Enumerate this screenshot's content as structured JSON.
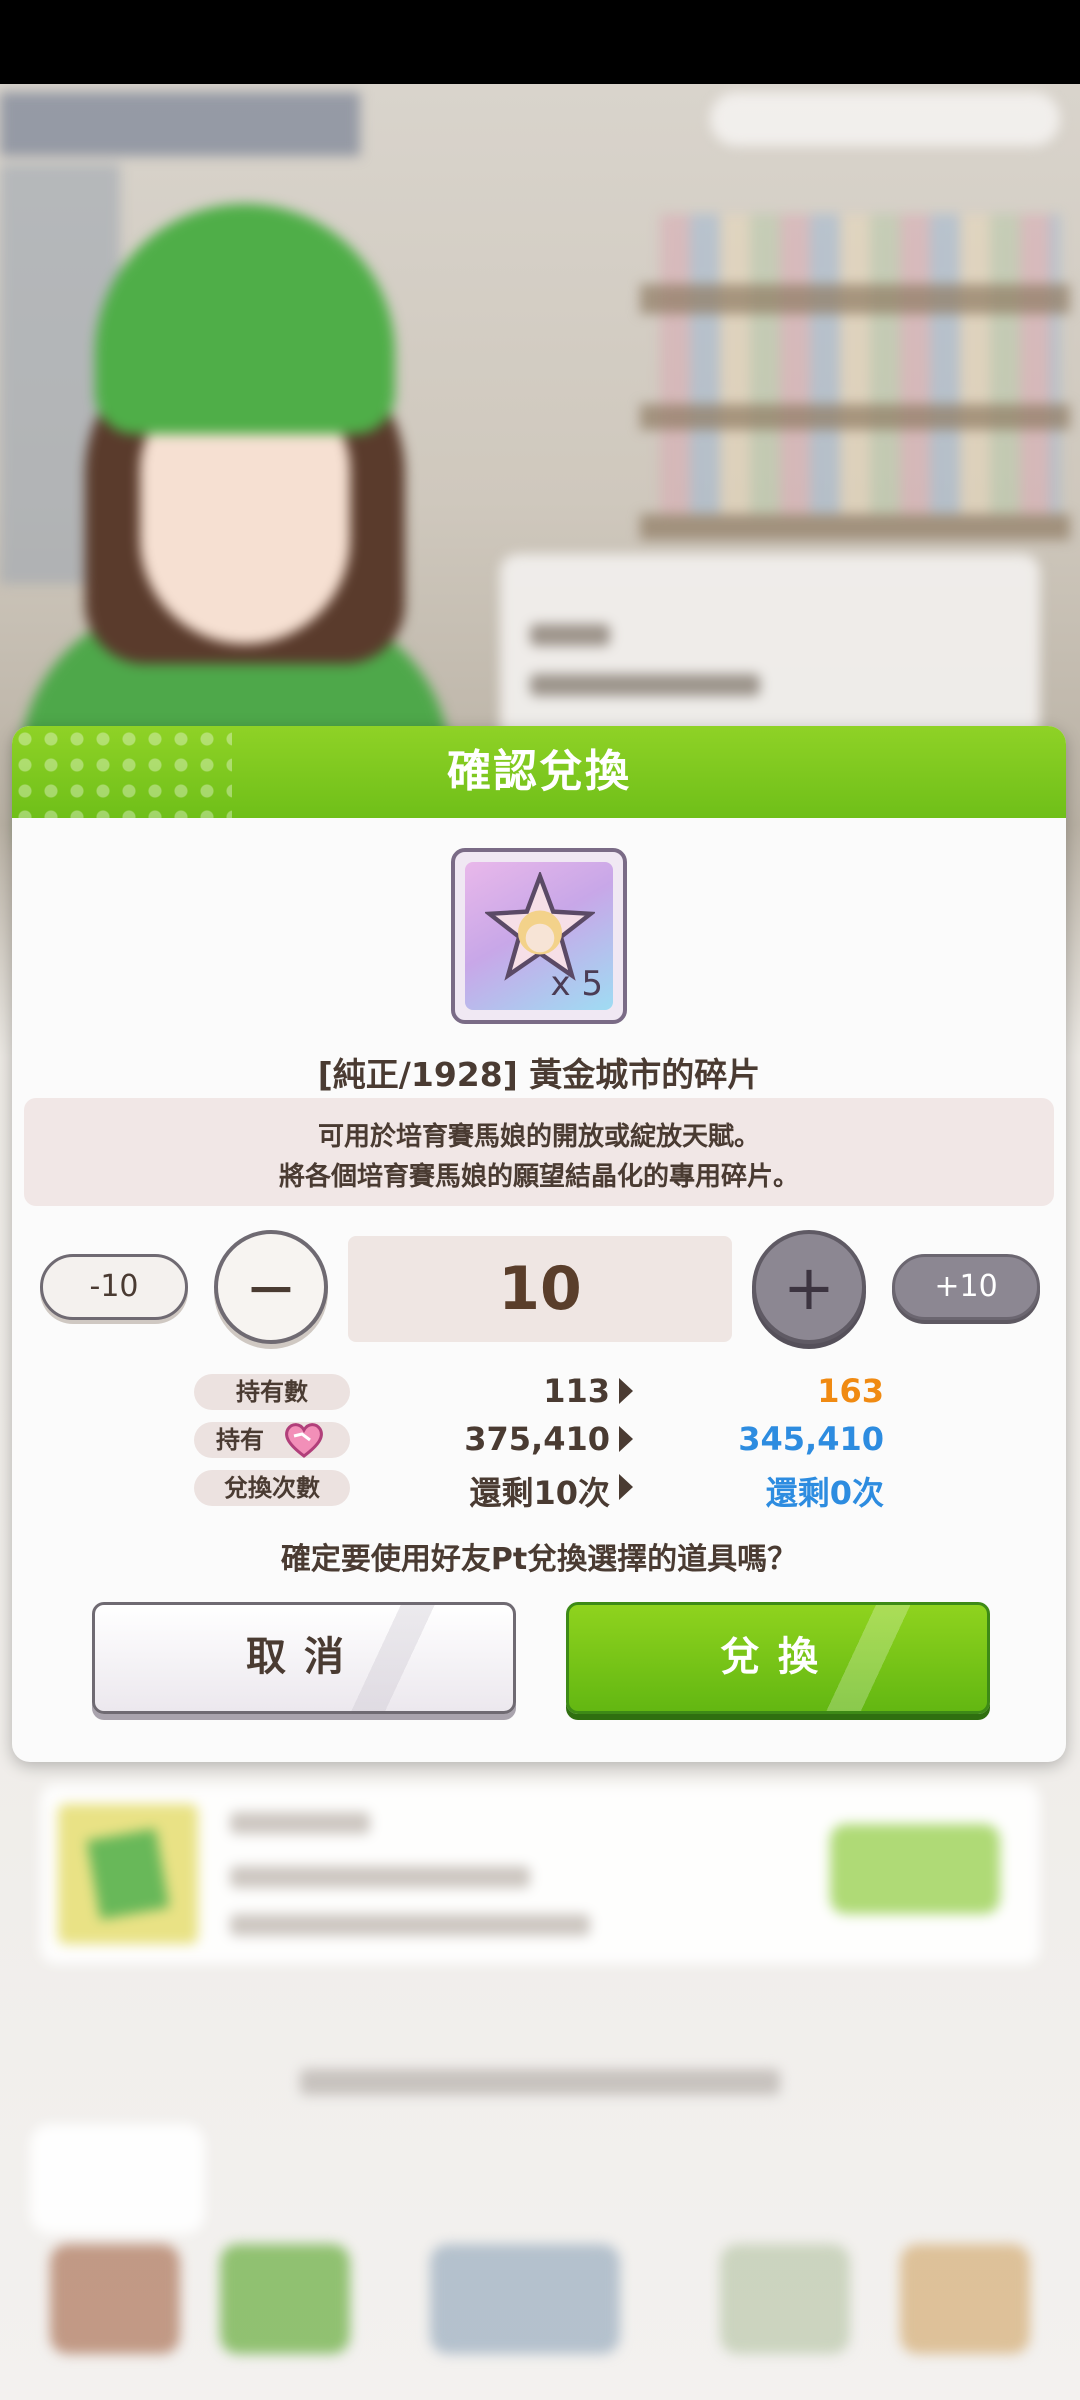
{
  "dialog": {
    "title": "確認兌換",
    "item": {
      "quantity_badge": "x 5",
      "name": "[純正/1928] 黃金城市的碎片",
      "description_line1": "可用於培育賽馬娘的開放或綻放天賦。",
      "description_line2": "將各個培育賽馬娘的願望結晶化的專用碎片。"
    },
    "stepper": {
      "minus10_label": "-10",
      "plus10_label": "+10",
      "minus1_label": "−",
      "plus1_label": "+",
      "value": "10"
    },
    "summary": [
      {
        "label": "持有數",
        "current": "113",
        "after": "163"
      },
      {
        "label": "持有",
        "current": "375,410",
        "after": "345,410"
      },
      {
        "label": "兌換次數",
        "current": "還剩10次",
        "after": "還剩0次"
      }
    ],
    "confirm_question": "確定要使用好友Pt兌換選擇的道具嗎？",
    "cancel_label": "取消",
    "ok_label": "兌換"
  },
  "colors": {
    "header_green": "#7cc81e",
    "accent_orange": "#f08a12",
    "accent_blue": "#2d8ce0",
    "text_brown": "#4a3b32"
  }
}
